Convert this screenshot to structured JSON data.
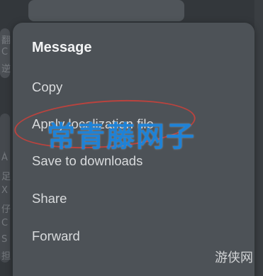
{
  "popup": {
    "title": "Message",
    "items": [
      {
        "label": "Copy"
      },
      {
        "label": "Apply localization file"
      },
      {
        "label": "Save to downloads"
      },
      {
        "label": "Share"
      },
      {
        "label": "Forward"
      }
    ]
  },
  "overlay": {
    "watermark_text": "常青藤网子",
    "corner_logo_text": "游侠网",
    "highlight_color": "#c7413c",
    "watermark_color": "#1f82d6"
  },
  "background": {
    "left_glyphs": [
      "翻",
      "C",
      "逆",
      "À",
      "足",
      "X",
      "仔",
      "C",
      "S",
      "担"
    ]
  }
}
